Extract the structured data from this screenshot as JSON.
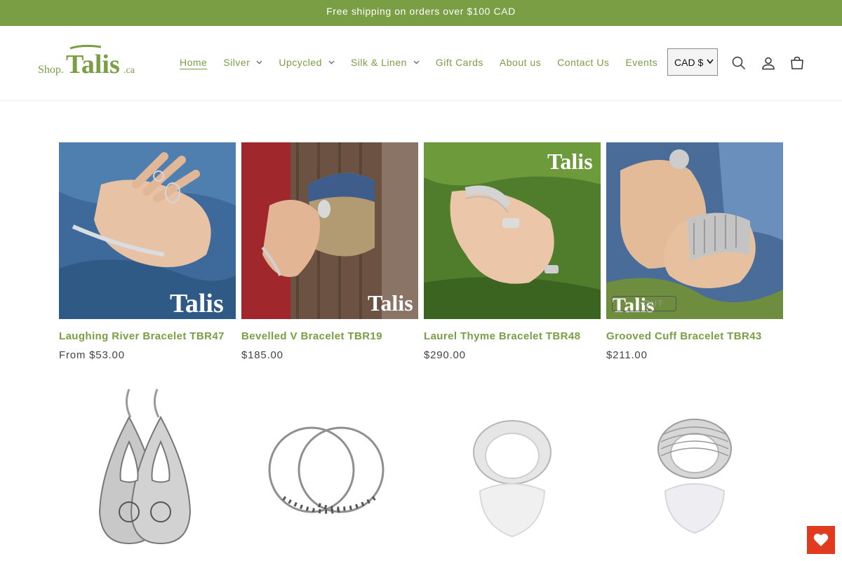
{
  "announcement": "Free shipping on orders over $100 CAD",
  "logo": {
    "prefix": "Shop.",
    "name": "Talis",
    "suffix": ".ca"
  },
  "nav": [
    {
      "label": "Home",
      "dropdown": false,
      "active": true
    },
    {
      "label": "Silver",
      "dropdown": true,
      "active": false
    },
    {
      "label": "Upcycled",
      "dropdown": true,
      "active": false
    },
    {
      "label": "Silk & Linen",
      "dropdown": true,
      "active": false
    },
    {
      "label": "Gift Cards",
      "dropdown": false,
      "active": false
    },
    {
      "label": "About us",
      "dropdown": false,
      "active": false
    },
    {
      "label": "Contact Us",
      "dropdown": false,
      "active": false
    },
    {
      "label": "Events",
      "dropdown": false,
      "active": false
    }
  ],
  "currency": {
    "selected": "CAD $"
  },
  "icons": {
    "search": "search-icon",
    "account": "account-icon",
    "cart": "cart-icon",
    "wishlist": "heart-icon"
  },
  "products": [
    {
      "title": "Laughing River Bracelet TBR47",
      "price": "From $53.00",
      "watermark": "Talis"
    },
    {
      "title": "Bevelled V Bracelet TBR19",
      "price": "$185.00",
      "watermark": "Talis"
    },
    {
      "title": "Laurel Thyme Bracelet TBR48",
      "price": "$290.00",
      "watermark": "Talis"
    },
    {
      "title": "Grooved Cuff Bracelet TBR43",
      "price": "$211.00",
      "watermark": "Talis",
      "badge": "OUT"
    },
    {
      "title": "",
      "price": ""
    },
    {
      "title": "",
      "price": ""
    },
    {
      "title": "",
      "price": ""
    },
    {
      "title": "",
      "price": ""
    }
  ],
  "colors": {
    "accent": "#7a9e44",
    "wishlist": "#e03b1f"
  }
}
